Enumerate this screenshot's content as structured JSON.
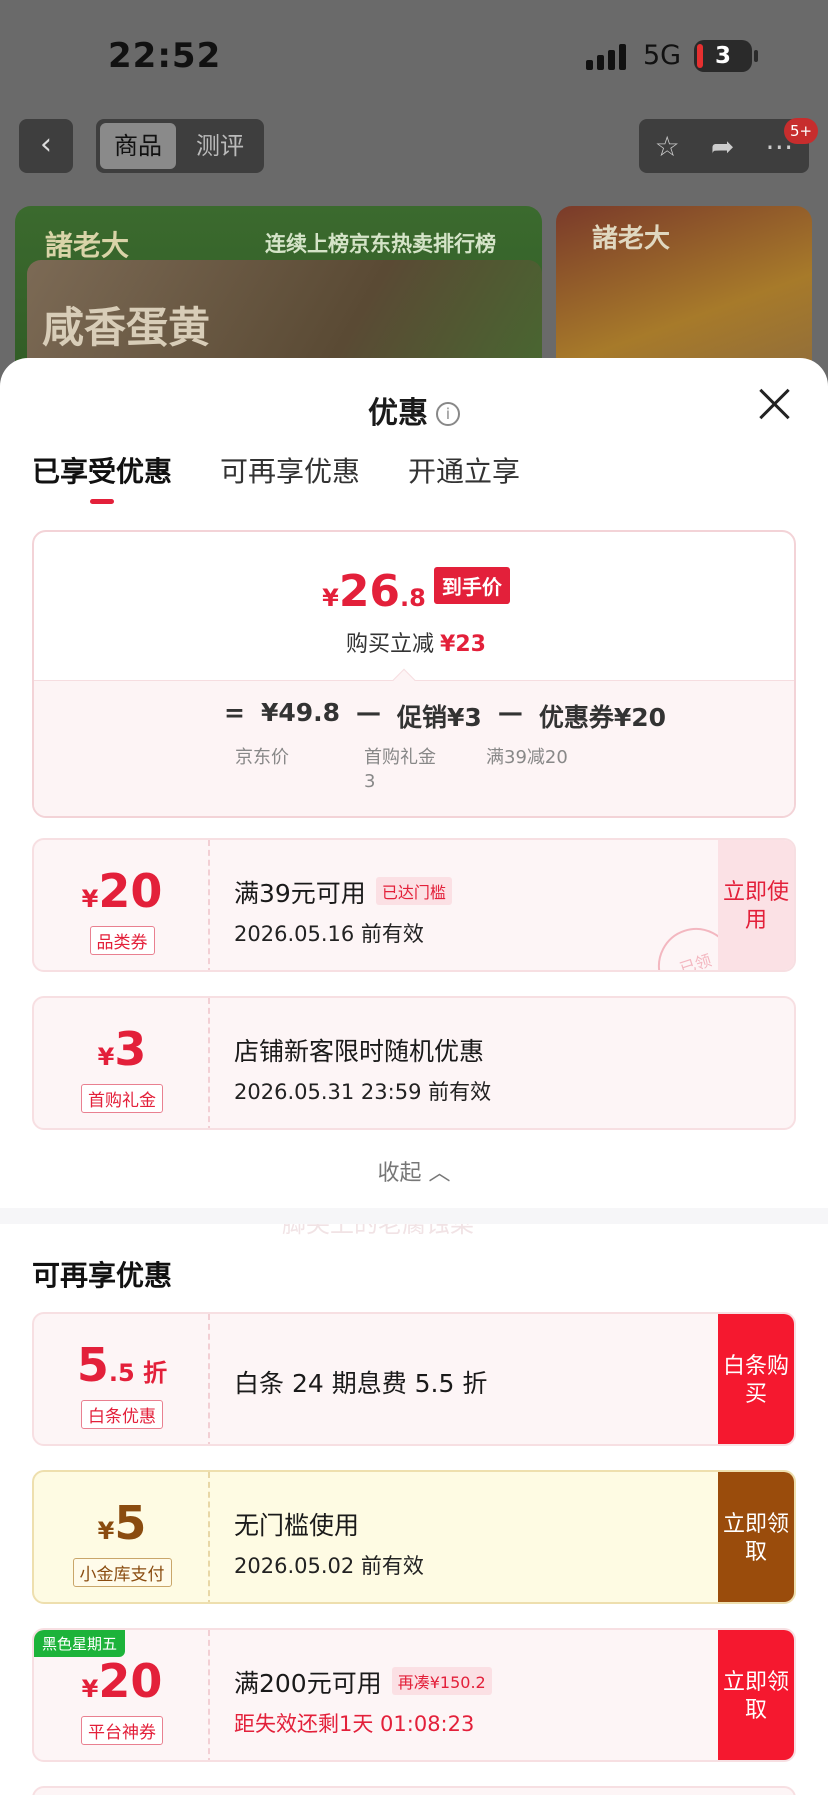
{
  "status": {
    "time": "22:52",
    "network": "5G",
    "battery": "3"
  },
  "nav": {
    "back_icon": "chevron-left-icon",
    "segments": [
      "商品",
      "测评"
    ],
    "active_segment": "商品",
    "badge": "5+"
  },
  "banner": {
    "brand": "諸老大",
    "slogan": "连续上榜京东热卖排行榜",
    "headline": "咸香蛋黄",
    "brand2": "諸老大"
  },
  "sheet": {
    "title": "优惠",
    "tabs": [
      "已享受优惠",
      "可再享优惠",
      "开通立享"
    ],
    "summary": {
      "currency": "¥",
      "price_int": "26",
      "price_dec": ".8",
      "price_tag": "到手价",
      "save_label": "购买立减",
      "save_value": "¥23",
      "formula": [
        "=",
        "¥49.8",
        "—",
        "促销¥3",
        "—",
        "优惠券¥20"
      ],
      "sub_labels": [
        "京东价",
        "首购礼金\n3",
        "满39减20"
      ]
    },
    "enjoyed": [
      {
        "currency": "¥",
        "amount": "20",
        "kind": "品类券",
        "title": "满39元可用",
        "badge": "已达门槛",
        "date": "2026.05.16 前有效",
        "cta": "立即使用",
        "stamp": "已领"
      },
      {
        "currency": "¥",
        "amount": "3",
        "kind": "首购礼金",
        "title": "店铺新客限时随机优惠",
        "date": "2026.05.31 23:59 前有效"
      }
    ],
    "watermark": "脚尖上的老腐蚀菜",
    "collapse_label": "收起",
    "more_title": "可再享优惠",
    "more": [
      {
        "amount": "5",
        "unit": ".5 折",
        "kind": "白条优惠",
        "title": "白条 24 期息费 5.5 折",
        "cta": "白条购买"
      },
      {
        "currency": "¥",
        "amount": "5",
        "kind": "小金库支付",
        "title": "无门槛使用",
        "date": "2026.05.02 前有效",
        "cta": "立即领取"
      },
      {
        "corner": "黑色星期五",
        "currency": "¥",
        "amount": "20",
        "kind": "平台神券",
        "title": "满200元可用",
        "badge": "再凑¥150.2",
        "date": "距失效还剩1天 01:08:23",
        "cta": "立即领取"
      }
    ]
  },
  "colors": {
    "accent": "#e3203a",
    "gold": "#9a4c0c",
    "green_tag": "#1db33a"
  }
}
